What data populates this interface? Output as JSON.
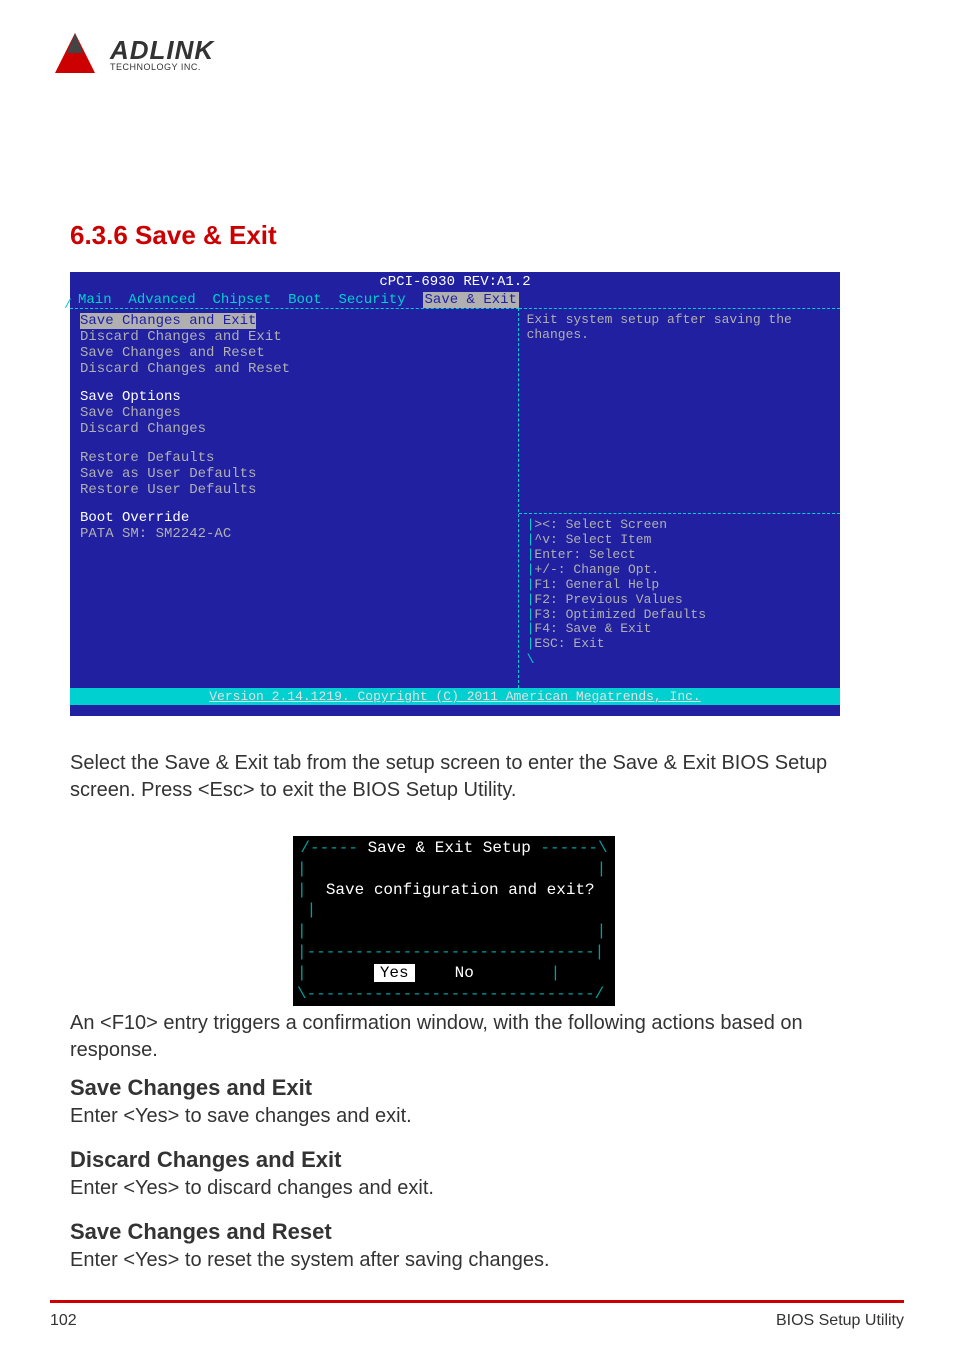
{
  "logo": {
    "main": "ADLINK",
    "sub": "TECHNOLOGY INC."
  },
  "section_heading": "6.3.6 Save & Exit",
  "bios": {
    "header": "cPCI-6930 REV:A1.2",
    "tabs": {
      "t0": "Main",
      "t1": "Advanced",
      "t2": "Chipset",
      "t3": "Boot",
      "t4": "Security",
      "active": "Save & Exit"
    },
    "left": {
      "selected": "Save Changes and Exit",
      "l1": "Discard Changes and Exit",
      "l2": "Save Changes and Reset",
      "l3": "Discard Changes and Reset",
      "g1": "Save Options",
      "l4": "Save Changes",
      "l5": "Discard Changes",
      "l6": "Restore Defaults",
      "l7": "Save as User Defaults",
      "l8": "Restore User Defaults",
      "g2": "Boot Override",
      "l9": "PATA  SM: SM2242-AC"
    },
    "right": {
      "help": "Exit system setup after saving the changes.",
      "k0": "><: Select Screen",
      "k1": "^v: Select Item",
      "k2": "Enter: Select",
      "k3": "+/-: Change Opt.",
      "k4": "F1: General Help",
      "k5": "F2: Previous Values",
      "k6": "F3: Optimized Defaults",
      "k7": "F4: Save & Exit",
      "k8": "ESC: Exit"
    },
    "footer": "Version 2.14.1219. Copyright (C) 2011 American Megatrends, Inc."
  },
  "para1": "Select the Save & Exit tab from the setup screen to enter the Save & Exit BIOS Setup screen. Press <Esc> to exit the BIOS Setup Utility.",
  "dialog": {
    "title": "Save & Exit Setup",
    "question": "Save configuration and exit?",
    "yes": "Yes",
    "no": "No"
  },
  "para2": "An <F10> entry triggers a confirmation window, with the following actions based on response.",
  "options": {
    "o1t": "Save Changes and Exit",
    "o1d": "Enter <Yes> to save changes and exit.",
    "o2t": "Discard Changes and Exit",
    "o2d": "Enter <Yes> to discard changes and exit.",
    "o3t": "Save Changes and Reset",
    "o3d": "Enter <Yes> to reset the system after saving changes."
  },
  "footer": {
    "left": "102",
    "right": "BIOS Setup Utility"
  }
}
